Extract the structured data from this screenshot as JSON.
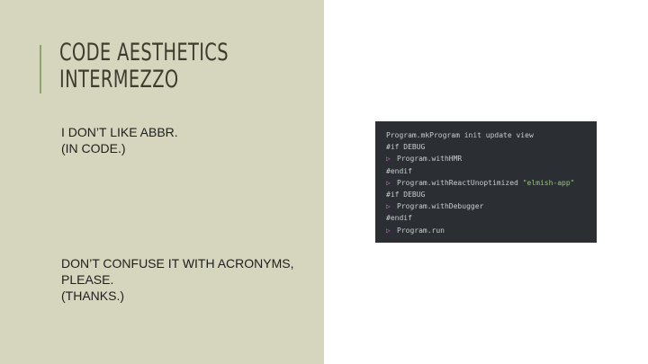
{
  "slide": {
    "title_line1": "CODE AESTHETICS",
    "title_line2": "INTERMEZZO",
    "text1_line1": "I DON’T LIKE ABBR.",
    "text1_line2": "(IN CODE.)",
    "text2_line1": "DON’T CONFUSE IT WITH ACRONYMS,",
    "text2_line2": "PLEASE.",
    "text2_line3": "(THANKS.)"
  },
  "code": {
    "arrow_symbol": "▷",
    "lines": [
      {
        "text": "Program.mkProgram init update view"
      },
      {
        "text": "#if DEBUG"
      },
      {
        "text": "Program.withHMR"
      },
      {
        "text": "#endif"
      },
      {
        "text": "Program.withReactUnoptimized ",
        "string": "\"elmish-app\""
      },
      {
        "text": "#if DEBUG"
      },
      {
        "text": "Program.withDebugger"
      },
      {
        "text": "#endif"
      },
      {
        "text": "Program.run"
      }
    ]
  },
  "colors": {
    "left_panel_bg": "#d6d6bf",
    "accent": "#8aa66a",
    "code_bg": "#2b2e33",
    "code_arrow": "#c36fd6",
    "code_string": "#98c379"
  }
}
